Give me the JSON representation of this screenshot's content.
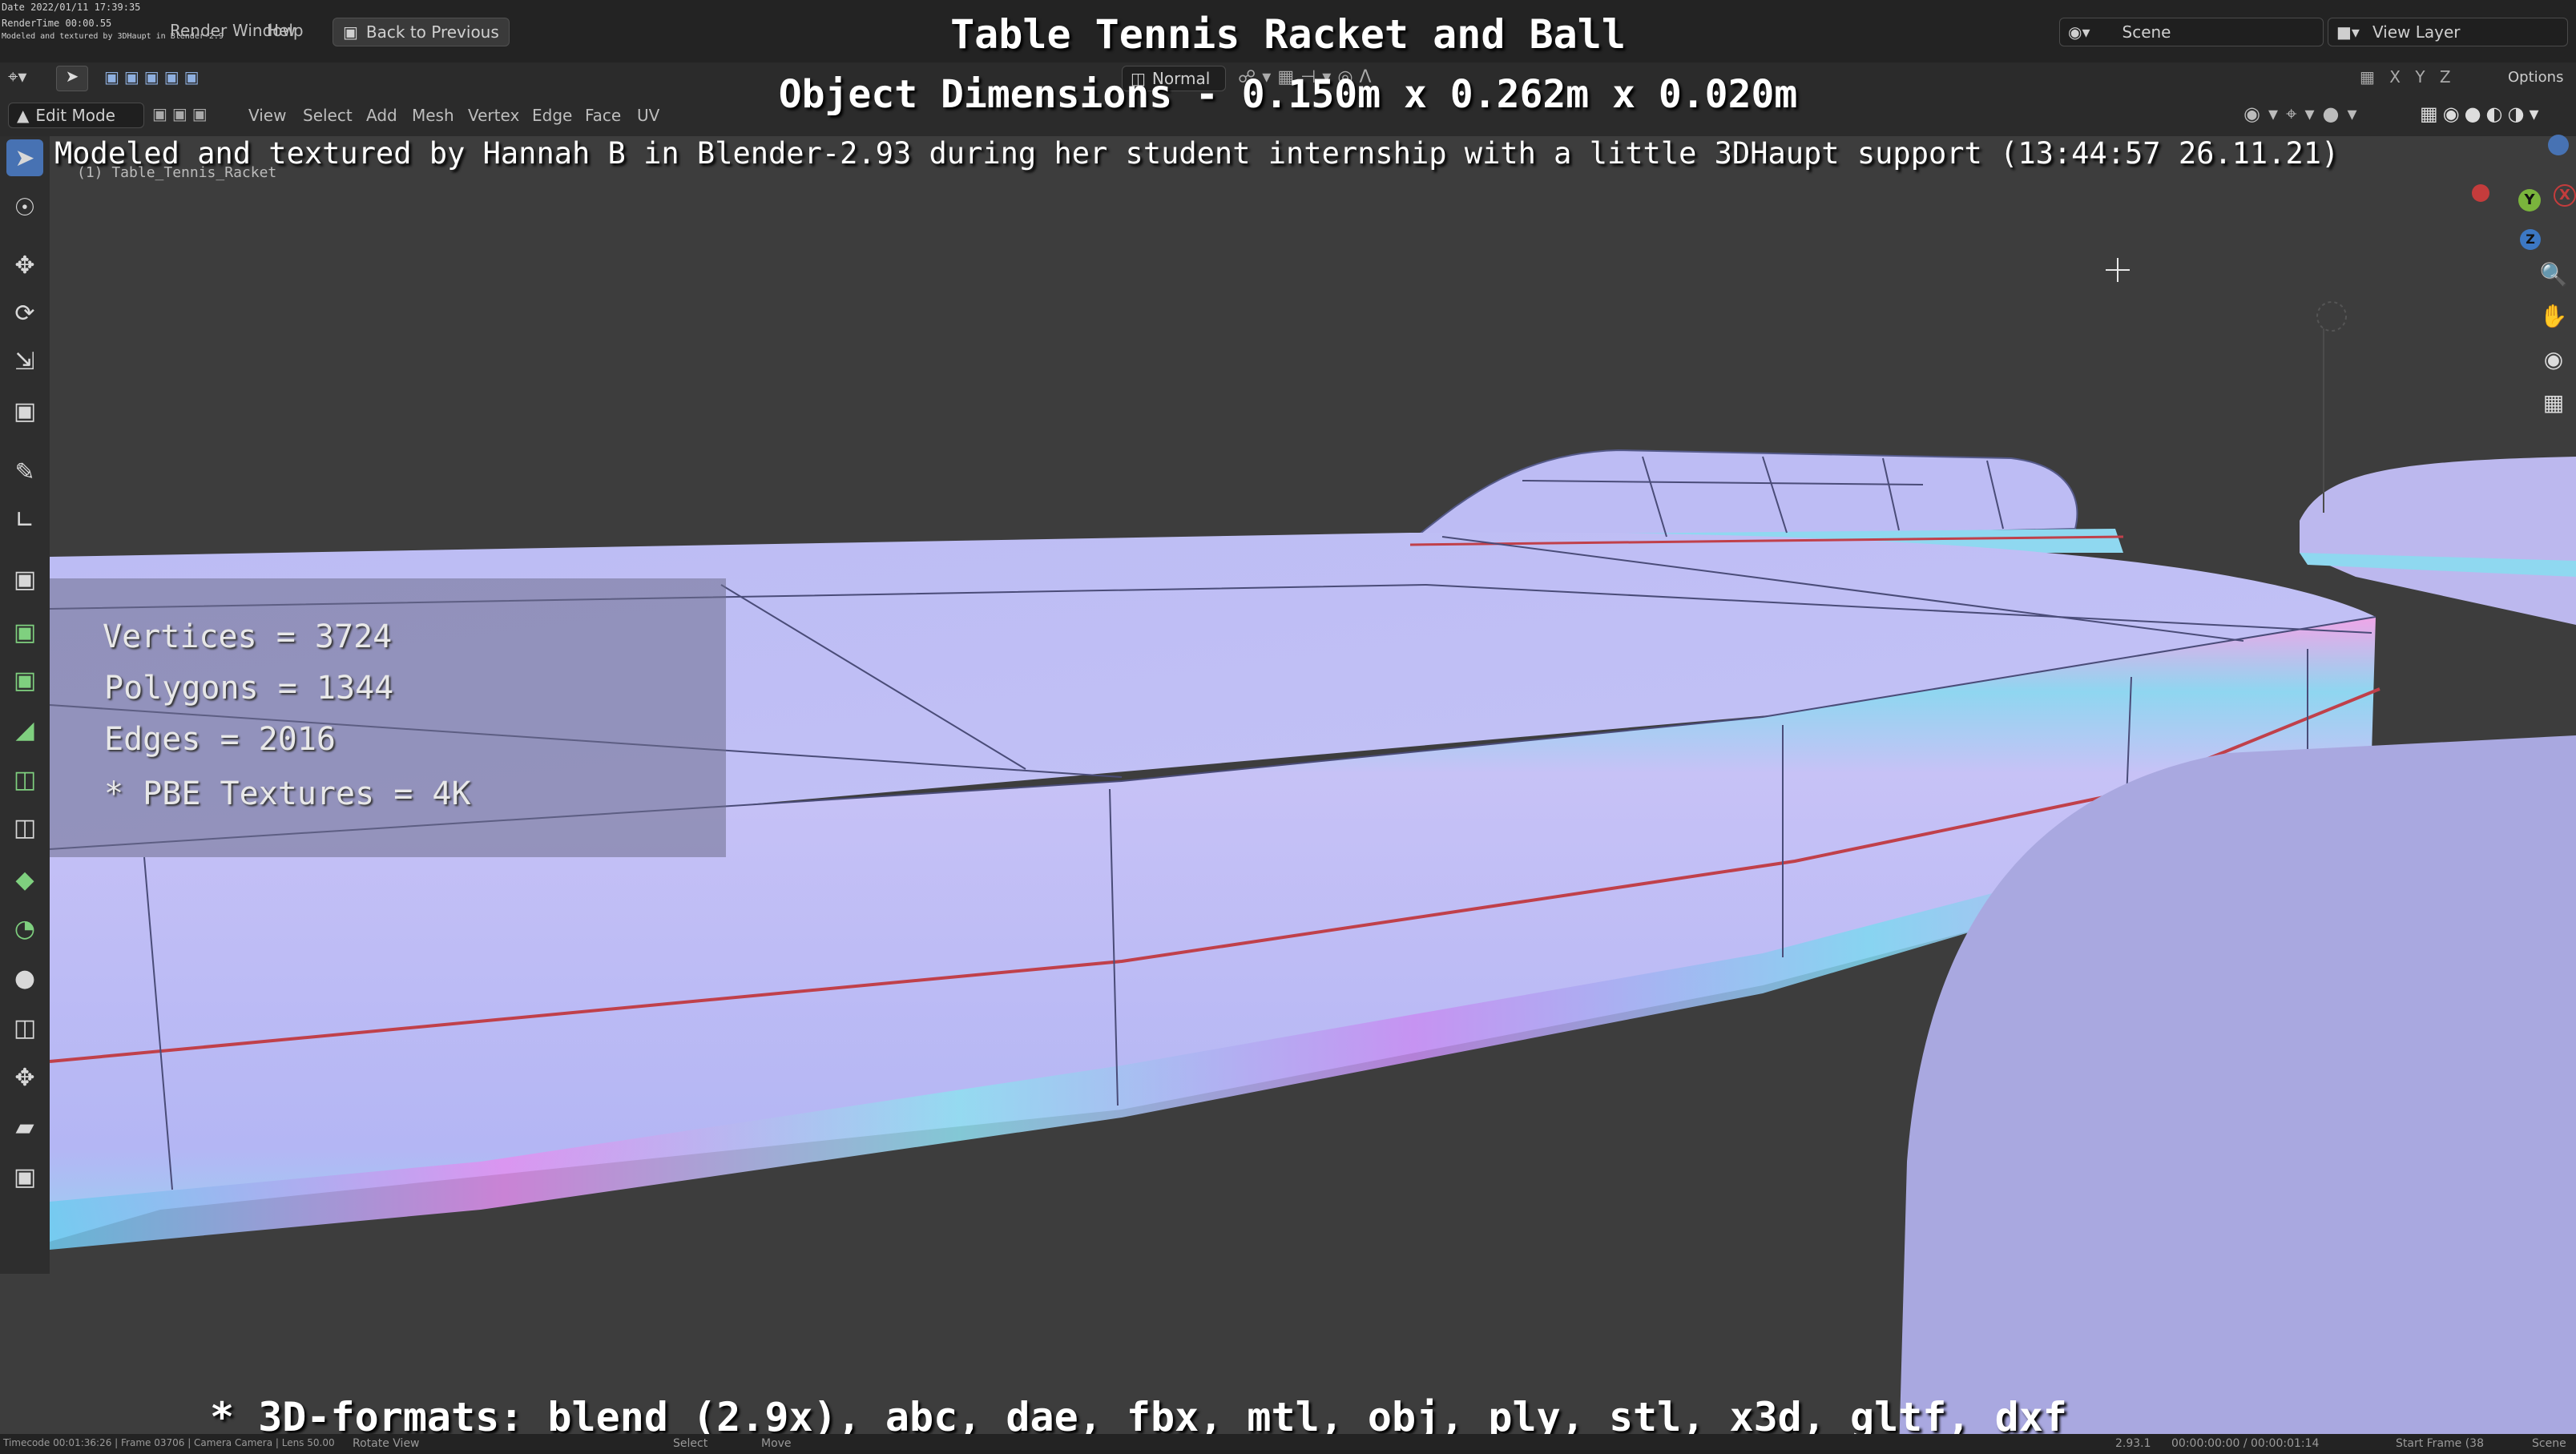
{
  "overlay": {
    "title": "Table Tennis Racket and Ball",
    "dimensions": "Object Dimensions -  0.150m x 0.262m x 0.020m",
    "credit": "Modeled and textured by Hannah B in Blender-2.93 during her student internship with a little 3DHaupt support (13:44:57 26.11.21)",
    "formats": "* 3D-formats: blend (2.9x), abc, dae, fbx, mtl, obj, ply, stl, x3d, gltf, dxf"
  },
  "stats": {
    "vertices": "Vertices = 3724",
    "polygons": "Polygons = 1344",
    "edges": "Edges = 2016",
    "textures": "* PBE Textures = 4K"
  },
  "stamp": {
    "date": "Date 2022/01/11 17:39:35",
    "render_time": "RenderTime 00:00.55",
    "note": "Modeled and textured by 3DHaupt in Blender-2.9"
  },
  "topbar": {
    "menus": [
      "Render",
      "Window",
      "Help"
    ],
    "back_button": "Back to Previous",
    "scene_label": "Scene",
    "view_layer_label": "View Layer"
  },
  "header2": {
    "orientation": "Normal",
    "options": "Options"
  },
  "header3": {
    "mode": "Edit Mode",
    "menus": [
      "View",
      "Select",
      "Add",
      "Mesh",
      "Vertex",
      "Edge",
      "Face",
      "UV"
    ]
  },
  "viewport": {
    "object_label": "(1) Table_Tennis_Racket",
    "gizmo": {
      "x": "X",
      "y": "Y",
      "z": "Z"
    }
  },
  "statusbar": {
    "left": "Timecode 00:01:36:26 | Frame 03706 | Camera Camera | Lens 50.00",
    "rotate": "Rotate View",
    "select": "Select",
    "move": "Move",
    "version": "2.93.1",
    "time": "00:00:00:00 / 00:00:01:14",
    "start": "Start Frame (38",
    "scene": "Scene"
  },
  "colors": {
    "accent": "#4772b3",
    "mesh": "#b8b6f0",
    "seam": "#c0404a",
    "background": "#3d3d3d"
  }
}
